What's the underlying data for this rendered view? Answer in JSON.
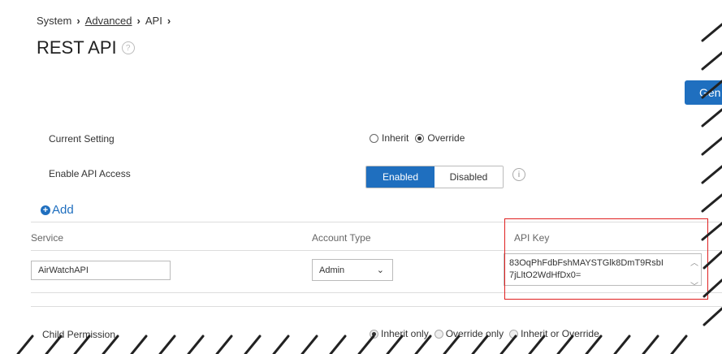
{
  "breadcrumb": {
    "item1": "System",
    "item2": "Advanced",
    "item3": "API"
  },
  "page": {
    "title": "REST API"
  },
  "toolbar": {
    "generate_label": "Gen"
  },
  "settings": {
    "current_setting_label": "Current Setting",
    "inherit_label": "Inherit",
    "override_label": "Override",
    "selected": "Override",
    "enable_api_label": "Enable API Access",
    "enabled_label": "Enabled",
    "disabled_label": "Disabled",
    "api_access_state": "Enabled"
  },
  "add_label": "Add",
  "table": {
    "headers": {
      "service": "Service",
      "account_type": "Account Type",
      "api_key": "API Key"
    },
    "row": {
      "service": "AirWatchAPI",
      "account_type": "Admin",
      "api_key_line1": "83OqPhFdbFshMAYSTGlk8DmT9RsbI",
      "api_key_line2": "7jLltO2WdHfDx0="
    }
  },
  "child_permission": {
    "label": "Child Permission",
    "opt1": "Inherit only",
    "opt2": "Override only",
    "opt3": "Inherit or Override"
  },
  "colors": {
    "accent": "#1f6fbf",
    "highlight": "#e02020"
  }
}
